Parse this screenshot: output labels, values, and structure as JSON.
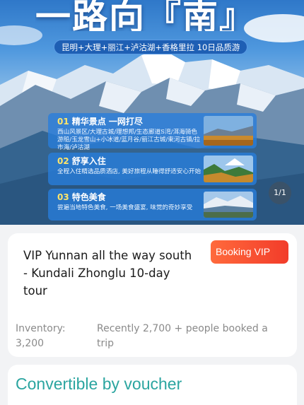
{
  "hero": {
    "title": "一路向『南』",
    "route": "昆明+大理+丽江+泸沽湖+香格里拉 10日品质游",
    "features": [
      {
        "num": "01",
        "title": "精华景点 一网打尽",
        "desc": "西山风景区/大理古城/理想邦/生态廊道S湾/洱海骑色游船/玉龙雪山+小冰道/蓝月谷/丽江古城/束河古镇/拉市海/泸沽湖"
      },
      {
        "num": "02",
        "title": "舒享入住",
        "desc": "全程入住精选品质酒店, 美好旅程从睡得舒适安心开始"
      },
      {
        "num": "03",
        "title": "特色美食",
        "desc": "尝遍当地特色美食, 一场美食盛宴, 味觉的奇妙享受"
      }
    ],
    "pager": "1/1"
  },
  "product": {
    "title": "VIP Yunnan all the way south - Kundali Zhonglu 10-day tour",
    "booking_label": "Booking VIP",
    "inventory_label": "Inventory:",
    "inventory_value": "3,200",
    "booked_text": "Recently 2,700 + people booked a trip"
  },
  "voucher": {
    "title": "Convertible by voucher"
  },
  "colors": {
    "accent_teal": "#2ba5a0",
    "booking_red": "#f23c2a",
    "feature_blue": "#287ddc",
    "highlight_yellow": "#ffe56a"
  }
}
